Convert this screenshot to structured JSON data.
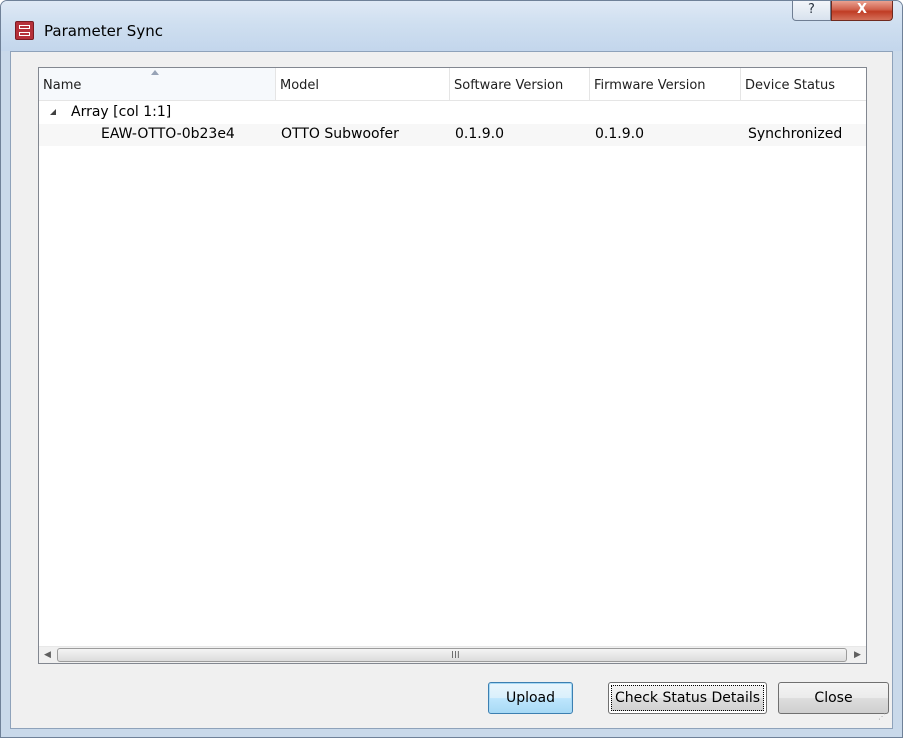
{
  "window": {
    "title": "Parameter Sync",
    "help_label": "?",
    "close_label": "X"
  },
  "table": {
    "columns": [
      {
        "label": "Name"
      },
      {
        "label": "Model"
      },
      {
        "label": "Software Version"
      },
      {
        "label": "Firmware Version"
      },
      {
        "label": "Device Status"
      }
    ],
    "sorted_column": "Name",
    "groups": [
      {
        "label": "Array [col 1:1]",
        "expanded": true,
        "rows": [
          {
            "name": "EAW-OTTO-0b23e4",
            "model": "OTTO Subwoofer",
            "software_version": "0.1.9.0",
            "firmware_version": "0.1.9.0",
            "device_status": "Synchronized"
          }
        ]
      }
    ]
  },
  "scrollbar": {
    "left_arrow": "◀",
    "right_arrow": "▶",
    "grip": "III"
  },
  "buttons": {
    "upload": "Upload",
    "check_status": "Check Status Details",
    "close": "Close"
  }
}
